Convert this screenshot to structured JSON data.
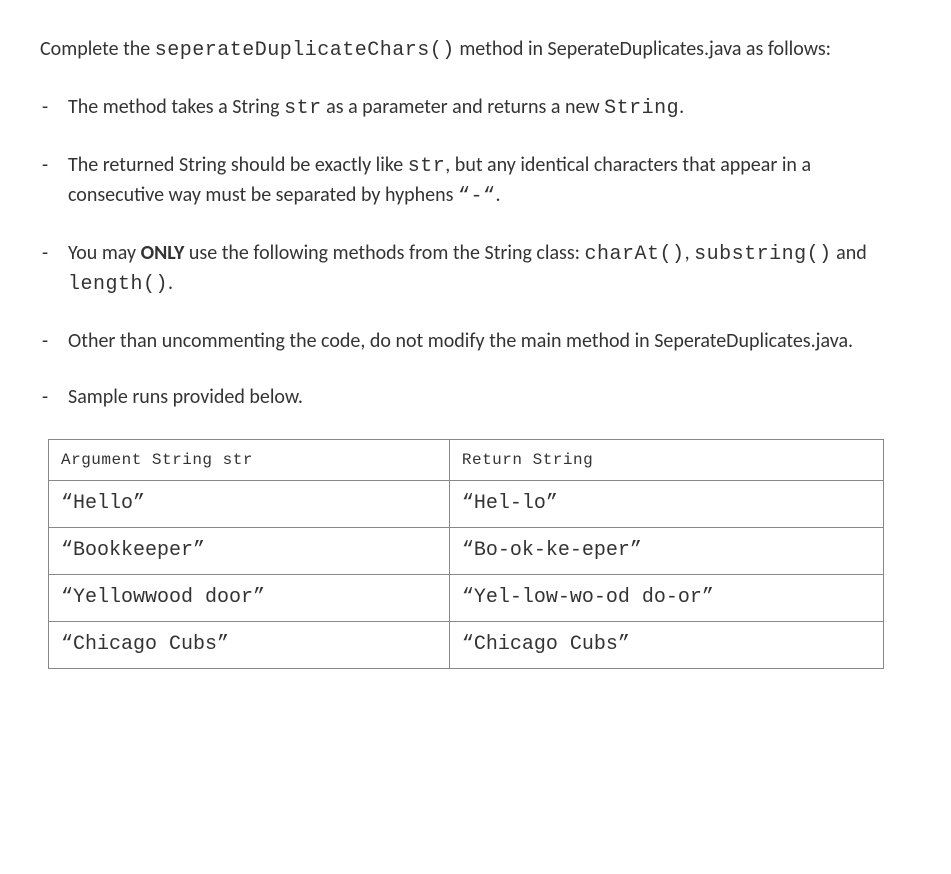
{
  "intro": {
    "pre": "Complete the ",
    "code": "seperateDuplicateChars()",
    "post": " method in SeperateDuplicates.java as follows:"
  },
  "bullets": {
    "b1": {
      "t1": "The method takes a String ",
      "c1": "str",
      "t2": " as a parameter and returns a new ",
      "c2": "String",
      "t3": "."
    },
    "b2": {
      "t1": "The returned String should be exactly like ",
      "c1": "str",
      "t2": ", but any identical characters that appear in a consecutive way must be separated by hyphens ",
      "c2": "“-“",
      "t3": "."
    },
    "b3": {
      "t1": "You may ",
      "bold": "ONLY",
      "t2": " use the following methods from the String class: ",
      "c1": "charAt()",
      "t3": ", ",
      "c2": "substring()",
      "t4": " and ",
      "c3": "length()",
      "t5": "."
    },
    "b4": "Other than uncommenting the code, do not modify the main method in SeperateDuplicates.java.",
    "b5": "Sample runs provided below."
  },
  "table": {
    "header": {
      "col1": "Argument String str",
      "col2": "Return String"
    },
    "rows": [
      {
        "arg": "“Hello”",
        "ret": "“Hel-lo”"
      },
      {
        "arg": "“Bookkeeper”",
        "ret": "“Bo-ok-ke-eper”"
      },
      {
        "arg": "“Yellowwood door”",
        "ret": "“Yel-low-wo-od do-or”"
      },
      {
        "arg": "“Chicago Cubs”",
        "ret": "“Chicago Cubs”"
      }
    ]
  }
}
